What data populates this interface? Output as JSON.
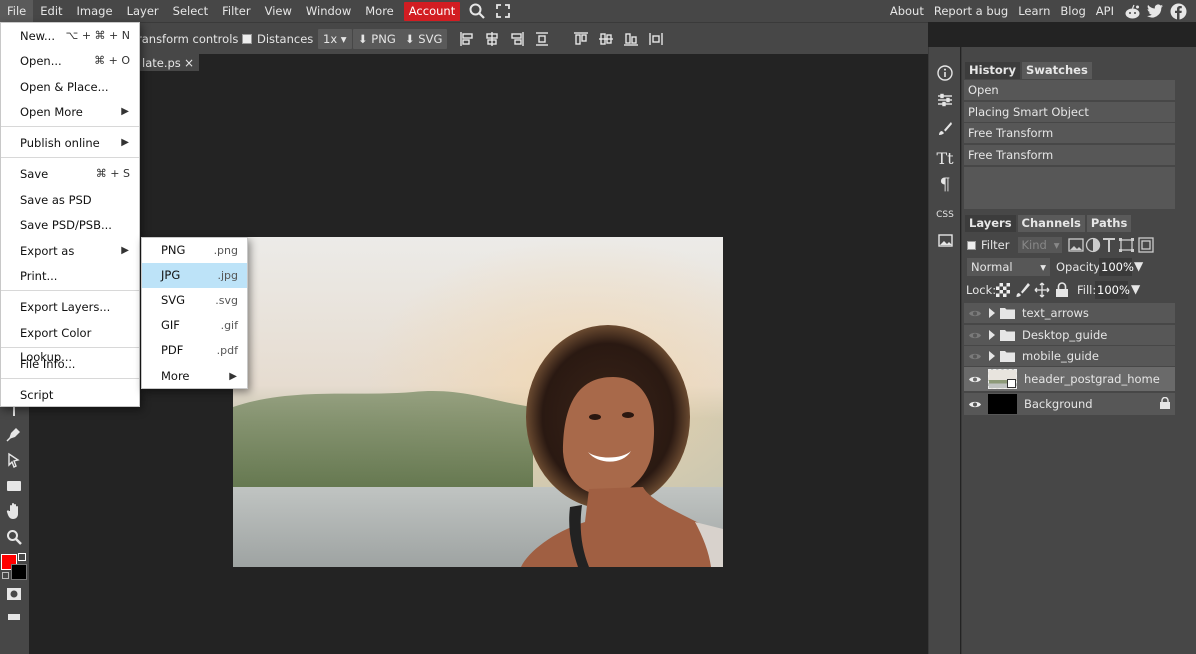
{
  "menubar": {
    "items": [
      "File",
      "Edit",
      "Image",
      "Layer",
      "Select",
      "Filter",
      "View",
      "Window",
      "More"
    ],
    "account": "Account",
    "right_links": [
      "About",
      "Report a bug",
      "Learn",
      "Blog",
      "API"
    ]
  },
  "optbar": {
    "transform_controls": "ransform controls",
    "distances": "Distances",
    "zoom": "1x",
    "png": "PNG",
    "svg": "SVG"
  },
  "tab": {
    "title": "late.ps",
    "close": "×"
  },
  "file_menu": {
    "items": [
      {
        "label": "New...",
        "shortcut": "⌥ + ⌘ + N"
      },
      {
        "label": "Open...",
        "shortcut": "⌘ + O"
      },
      {
        "label": "Open & Place..."
      },
      {
        "label": "Open More"
      },
      {
        "label": "Publish online"
      },
      {
        "label": "Save",
        "shortcut": "⌘ + S"
      },
      {
        "label": "Save as PSD"
      },
      {
        "label": "Save PSD/PSB..."
      },
      {
        "label": "Export as"
      },
      {
        "label": "Print..."
      },
      {
        "label": "Export Layers..."
      },
      {
        "label": "Export Color Lookup..."
      },
      {
        "label": "File Info..."
      },
      {
        "label": "Script"
      }
    ]
  },
  "export_menu": {
    "items": [
      {
        "label": "PNG",
        "ext": ".png"
      },
      {
        "label": "JPG",
        "ext": ".jpg"
      },
      {
        "label": "SVG",
        "ext": ".svg"
      },
      {
        "label": "GIF",
        "ext": ".gif"
      },
      {
        "label": "PDF",
        "ext": ".pdf"
      },
      {
        "label": "More"
      }
    ],
    "highlighted": "JPG"
  },
  "panels": {
    "collapse_left": "<>",
    "collapse_right": "><",
    "history_tab": "History",
    "swatches_tab": "Swatches",
    "history": [
      "Open",
      "Placing Smart Object",
      "Free Transform",
      "Free Transform"
    ],
    "layers_tab": "Layers",
    "channels_tab": "Channels",
    "paths_tab": "Paths",
    "filter_label": "Filter",
    "kind_value": "Kind",
    "blend_mode": "Normal",
    "opacity_label": "Opacity:",
    "opacity_value": "100%",
    "lock_label": "Lock:",
    "fill_label": "Fill:",
    "fill_value": "100%",
    "strip_css": "CSS",
    "layers": [
      {
        "name": "text_arrows",
        "type": "folder"
      },
      {
        "name": "Desktop_guide",
        "type": "folder"
      },
      {
        "name": "mobile_guide",
        "type": "folder"
      },
      {
        "name": "header_postgrad_home",
        "type": "smart"
      },
      {
        "name": "Background",
        "type": "background"
      }
    ]
  },
  "colors": {
    "foreground": "#ff0000",
    "background": "#000000",
    "accent": "#d21d22",
    "highlight": "#bde3f8"
  }
}
